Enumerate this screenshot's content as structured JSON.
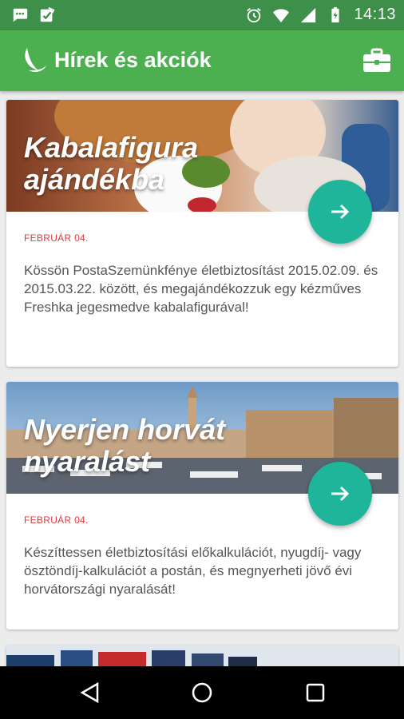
{
  "status_bar": {
    "time": "14:13",
    "left_icons": [
      "chat-notification-icon",
      "checklist-notification-icon"
    ],
    "right_icons": [
      "alarm-icon",
      "wifi-icon",
      "signal-icon",
      "battery-icon"
    ]
  },
  "app_bar": {
    "title": "Hírek és akciók",
    "logo_icon": "leaf-logo-icon",
    "action_icon": "briefcase-icon"
  },
  "news": [
    {
      "title_line1": "Kabalafigura",
      "title_line2": "ajándékba",
      "date": "FEBRUÁR 04.",
      "description": "Kössön PostaSzemünkfénye életbiztosítást 2015.02.09. és 2015.03.22. között, és megajándékozzuk egy kézműves Freshka jegesmedve kabalafigurával!"
    },
    {
      "title_line1": "Nyerjen horvát",
      "title_line2": "nyaralást",
      "date": "FEBRUÁR 04.",
      "description": "Készíttessen életbiztosítási előkalkulációt, nyugdíj- vagy ösztöndíj-kalkulációt a postán, és megnyerheti jövő évi horvátországi nyaralását!"
    }
  ],
  "colors": {
    "status_bar": "#3d8f49",
    "app_bar": "#4caf50",
    "fab": "#1fb59b",
    "date": "#e03a3a"
  }
}
